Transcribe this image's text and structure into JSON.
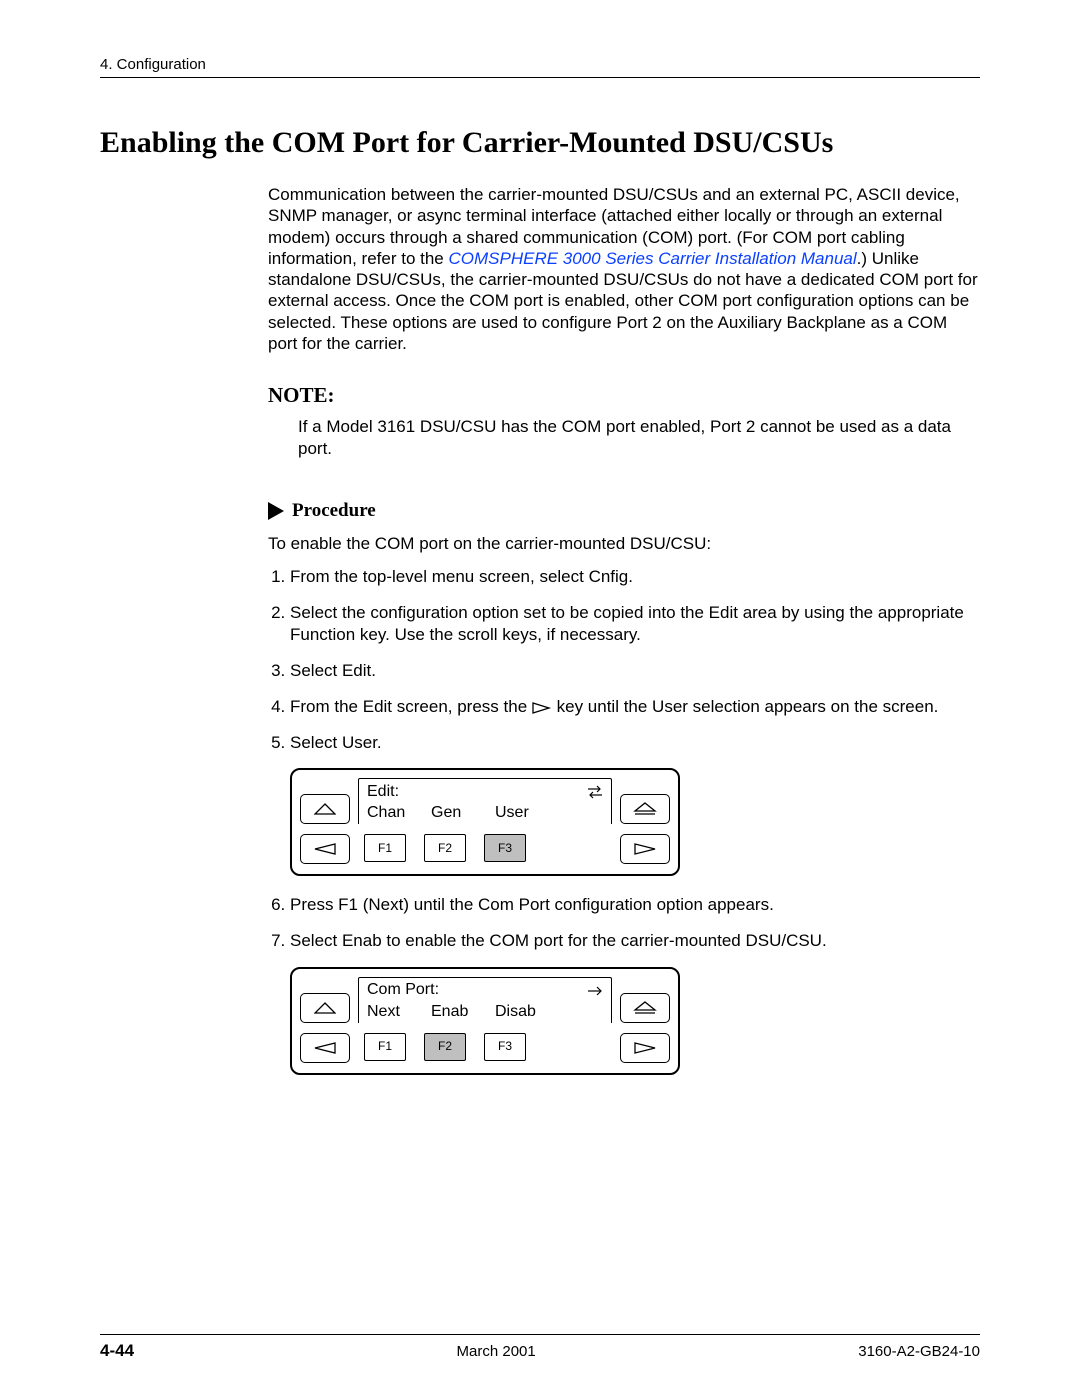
{
  "header": {
    "chapter": "4. Configuration"
  },
  "title": "Enabling the COM Port for Carrier-Mounted DSU/CSUs",
  "intro": {
    "p1a": "Communication between the carrier-mounted DSU/CSUs and an external PC, ASCII device, SNMP manager, or async terminal interface (attached either locally or through an external modem) occurs through a shared communication (COM) port. (For COM port cabling information, refer to the ",
    "link": "COMSPHERE 3000 Series Carrier Installation Manual",
    "p1b": ".) Unlike standalone DSU/CSUs, the carrier-mounted DSU/CSUs do not have a dedicated COM port for external access. Once the COM port is enabled, other COM port configuration options can be selected. These options are used to configure Port 2 on the Auxiliary Backplane as a COM port for the carrier."
  },
  "note": {
    "heading": "NOTE:",
    "body": "If a Model 3161 DSU/CSU has the COM port enabled, Port 2 cannot be used as a data port."
  },
  "procedure": {
    "label": "Procedure",
    "intro": "To enable the COM port on the carrier-mounted DSU/CSU:",
    "steps": {
      "s1": "From the top-level menu screen, select Cnfig.",
      "s2": "Select the configuration option set to be copied into the Edit area by using the appropriate Function key. Use the scroll keys, if necessary.",
      "s3": "Select Edit.",
      "s4a": "From the Edit screen, press the ",
      "s4b": " key until the User selection appears on the screen.",
      "s5": "Select User.",
      "s6": "Press F1 (Next) until the Com Port configuration option appears.",
      "s7": "Select Enab to enable the COM port for the carrier-mounted DSU/CSU."
    }
  },
  "panel1": {
    "title": "Edit:",
    "opts": [
      "Chan",
      "Gen",
      "User"
    ],
    "fkeys": [
      "F1",
      "F2",
      "F3"
    ],
    "selected": 2
  },
  "panel2": {
    "title": "Com Port:",
    "opts": [
      "Next",
      "Enab",
      "Disab"
    ],
    "fkeys": [
      "F1",
      "F2",
      "F3"
    ],
    "selected": 1
  },
  "footer": {
    "page": "4-44",
    "date": "March 2001",
    "doc": "3160-A2-GB24-10"
  }
}
